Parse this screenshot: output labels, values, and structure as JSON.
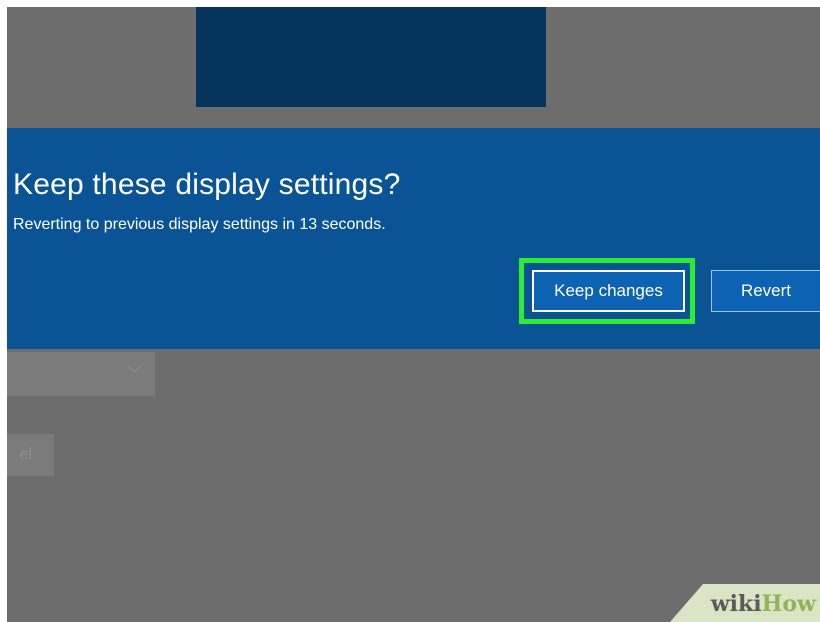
{
  "dialog": {
    "title": "Keep these display settings?",
    "message": "Reverting to previous display settings in 13 seconds.",
    "keep_button": "Keep changes",
    "revert_button": "Revert"
  },
  "background": {
    "cancel_partial_label": "el"
  },
  "watermark": {
    "part_a": "wiki",
    "part_b": "How"
  },
  "icons": {
    "dropdown": "chevron-down-icon"
  },
  "colors": {
    "dialog_bg": "#0a5394",
    "button_bg": "#0c63b4",
    "highlight": "#2cec33",
    "dimmed_overlay": "#6d6d6d",
    "monitor_preview": "#05345c"
  }
}
